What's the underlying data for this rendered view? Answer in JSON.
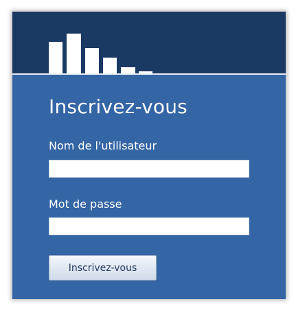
{
  "login": {
    "title": "Inscrivez-vous",
    "username_label": "Nom de l'utilisateur",
    "username_value": "",
    "password_label": "Mot de passe",
    "password_value": "",
    "submit_label": "Inscrivez-vous"
  },
  "colors": {
    "header": "#1a3963",
    "panel": "#3465a4",
    "text": "#ffffff"
  },
  "icons": {
    "logo": "bar-chart-logo-icon"
  }
}
